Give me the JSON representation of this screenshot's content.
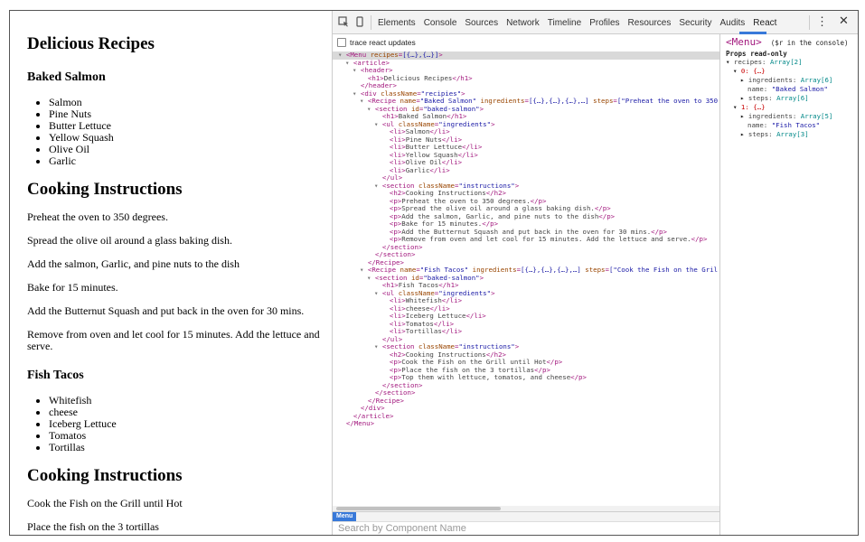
{
  "page": {
    "title": "Delicious Recipes",
    "recipes": [
      {
        "name": "Baked Salmon",
        "ingredients": [
          "Salmon",
          "Pine Nuts",
          "Butter Lettuce",
          "Yellow Squash",
          "Olive Oil",
          "Garlic"
        ],
        "instructions_title": "Cooking Instructions",
        "steps": [
          "Preheat the oven to 350 degrees.",
          "Spread the olive oil around a glass baking dish.",
          "Add the salmon, Garlic, and pine nuts to the dish",
          "Bake for 15 minutes.",
          "Add the Butternut Squash and put back in the oven for 30 mins.",
          "Remove from oven and let cool for 15 minutes. Add the lettuce and serve."
        ]
      },
      {
        "name": "Fish Tacos",
        "ingredients": [
          "Whitefish",
          "cheese",
          "Iceberg Lettuce",
          "Tomatos",
          "Tortillas"
        ],
        "instructions_title": "Cooking Instructions",
        "steps": [
          "Cook the Fish on the Grill until Hot",
          "Place the fish on the 3 tortillas",
          "Top them with lettuce, tomatos, and cheese"
        ]
      }
    ]
  },
  "devtools": {
    "tabs": [
      "Elements",
      "Console",
      "Sources",
      "Network",
      "Timeline",
      "Profiles",
      "Resources",
      "Security",
      "Audits",
      "React"
    ],
    "active_tab": "React",
    "trace_label": "trace react updates",
    "tree_lines": [
      {
        "d": 0,
        "a": "▾",
        "t": [
          [
            "tag",
            "<Menu "
          ],
          [
            "attr",
            "recipes"
          ],
          [
            "tag",
            "="
          ],
          [
            "val",
            "[{…},{…}]"
          ],
          [
            "tag",
            ">"
          ]
        ],
        "sel": true
      },
      {
        "d": 1,
        "a": "▾",
        "t": [
          [
            "tag",
            "<article>"
          ]
        ]
      },
      {
        "d": 2,
        "a": "▾",
        "t": [
          [
            "tag",
            "<header>"
          ]
        ]
      },
      {
        "d": 3,
        "a": "",
        "t": [
          [
            "tag",
            "<h1>"
          ],
          [
            "txt",
            "Delicious Recipes"
          ],
          [
            "tag",
            "</h1>"
          ]
        ]
      },
      {
        "d": 2,
        "a": "",
        "t": [
          [
            "tag",
            "</header>"
          ]
        ]
      },
      {
        "d": 2,
        "a": "▾",
        "t": [
          [
            "tag",
            "<div "
          ],
          [
            "attr",
            "className"
          ],
          [
            "tag",
            "="
          ],
          [
            "val",
            "\"recipies\""
          ],
          [
            "tag",
            ">"
          ]
        ]
      },
      {
        "d": 3,
        "a": "▾",
        "t": [
          [
            "tag",
            "<Recipe "
          ],
          [
            "attr",
            "name"
          ],
          [
            "tag",
            "="
          ],
          [
            "val",
            "\"Baked Salmon\""
          ],
          [
            "tag",
            " "
          ],
          [
            "attr",
            "ingredients"
          ],
          [
            "tag",
            "="
          ],
          [
            "val",
            "[{…},{…},{…},…]"
          ],
          [
            "tag",
            " "
          ],
          [
            "attr",
            "steps"
          ],
          [
            "tag",
            "="
          ],
          [
            "val",
            "[\"Preheat the oven to 350"
          ]
        ]
      },
      {
        "d": 4,
        "a": "▾",
        "t": [
          [
            "tag",
            "<section "
          ],
          [
            "attr",
            "id"
          ],
          [
            "tag",
            "="
          ],
          [
            "val",
            "\"baked-salmon\""
          ],
          [
            "tag",
            ">"
          ]
        ]
      },
      {
        "d": 5,
        "a": "",
        "t": [
          [
            "tag",
            "<h1>"
          ],
          [
            "txt",
            "Baked Salmon"
          ],
          [
            "tag",
            "</h1>"
          ]
        ]
      },
      {
        "d": 5,
        "a": "▾",
        "t": [
          [
            "tag",
            "<ul "
          ],
          [
            "attr",
            "className"
          ],
          [
            "tag",
            "="
          ],
          [
            "val",
            "\"ingredients\""
          ],
          [
            "tag",
            ">"
          ]
        ]
      },
      {
        "d": 6,
        "a": "",
        "t": [
          [
            "tag",
            "<li>"
          ],
          [
            "txt",
            "Salmon"
          ],
          [
            "tag",
            "</li>"
          ]
        ]
      },
      {
        "d": 6,
        "a": "",
        "t": [
          [
            "tag",
            "<li>"
          ],
          [
            "txt",
            "Pine Nuts"
          ],
          [
            "tag",
            "</li>"
          ]
        ]
      },
      {
        "d": 6,
        "a": "",
        "t": [
          [
            "tag",
            "<li>"
          ],
          [
            "txt",
            "Butter Lettuce"
          ],
          [
            "tag",
            "</li>"
          ]
        ]
      },
      {
        "d": 6,
        "a": "",
        "t": [
          [
            "tag",
            "<li>"
          ],
          [
            "txt",
            "Yellow Squash"
          ],
          [
            "tag",
            "</li>"
          ]
        ]
      },
      {
        "d": 6,
        "a": "",
        "t": [
          [
            "tag",
            "<li>"
          ],
          [
            "txt",
            "Olive Oil"
          ],
          [
            "tag",
            "</li>"
          ]
        ]
      },
      {
        "d": 6,
        "a": "",
        "t": [
          [
            "tag",
            "<li>"
          ],
          [
            "txt",
            "Garlic"
          ],
          [
            "tag",
            "</li>"
          ]
        ]
      },
      {
        "d": 5,
        "a": "",
        "t": [
          [
            "tag",
            "</ul>"
          ]
        ]
      },
      {
        "d": 5,
        "a": "▾",
        "t": [
          [
            "tag",
            "<section "
          ],
          [
            "attr",
            "className"
          ],
          [
            "tag",
            "="
          ],
          [
            "val",
            "\"instructions\""
          ],
          [
            "tag",
            ">"
          ]
        ]
      },
      {
        "d": 6,
        "a": "",
        "t": [
          [
            "tag",
            "<h2>"
          ],
          [
            "txt",
            "Cooking Instructions"
          ],
          [
            "tag",
            "</h2>"
          ]
        ]
      },
      {
        "d": 6,
        "a": "",
        "t": [
          [
            "tag",
            "<p>"
          ],
          [
            "txt",
            "Preheat the oven to 350 degrees."
          ],
          [
            "tag",
            "</p>"
          ]
        ]
      },
      {
        "d": 6,
        "a": "",
        "t": [
          [
            "tag",
            "<p>"
          ],
          [
            "txt",
            "Spread the olive oil around a glass baking dish."
          ],
          [
            "tag",
            "</p>"
          ]
        ]
      },
      {
        "d": 6,
        "a": "",
        "t": [
          [
            "tag",
            "<p>"
          ],
          [
            "txt",
            "Add the salmon, Garlic, and pine nuts to the dish"
          ],
          [
            "tag",
            "</p>"
          ]
        ]
      },
      {
        "d": 6,
        "a": "",
        "t": [
          [
            "tag",
            "<p>"
          ],
          [
            "txt",
            "Bake for 15 minutes."
          ],
          [
            "tag",
            "</p>"
          ]
        ]
      },
      {
        "d": 6,
        "a": "",
        "t": [
          [
            "tag",
            "<p>"
          ],
          [
            "txt",
            "Add the Butternut Squash and put back in the oven for 30 mins."
          ],
          [
            "tag",
            "</p>"
          ]
        ]
      },
      {
        "d": 6,
        "a": "",
        "t": [
          [
            "tag",
            "<p>"
          ],
          [
            "txt",
            "Remove from oven and let cool for 15 minutes. Add the lettuce and serve."
          ],
          [
            "tag",
            "</p>"
          ]
        ]
      },
      {
        "d": 5,
        "a": "",
        "t": [
          [
            "tag",
            "</section>"
          ]
        ]
      },
      {
        "d": 4,
        "a": "",
        "t": [
          [
            "tag",
            "</section>"
          ]
        ]
      },
      {
        "d": 3,
        "a": "",
        "t": [
          [
            "tag",
            "</Recipe>"
          ]
        ]
      },
      {
        "d": 3,
        "a": "▾",
        "t": [
          [
            "tag",
            "<Recipe "
          ],
          [
            "attr",
            "name"
          ],
          [
            "tag",
            "="
          ],
          [
            "val",
            "\"Fish Tacos\""
          ],
          [
            "tag",
            " "
          ],
          [
            "attr",
            "ingredients"
          ],
          [
            "tag",
            "="
          ],
          [
            "val",
            "[{…},{…},{…},…]"
          ],
          [
            "tag",
            " "
          ],
          [
            "attr",
            "steps"
          ],
          [
            "tag",
            "="
          ],
          [
            "val",
            "[\"Cook the Fish on the Gril"
          ]
        ]
      },
      {
        "d": 4,
        "a": "▾",
        "t": [
          [
            "tag",
            "<section "
          ],
          [
            "attr",
            "id"
          ],
          [
            "tag",
            "="
          ],
          [
            "val",
            "\"baked-salmon\""
          ],
          [
            "tag",
            ">"
          ]
        ]
      },
      {
        "d": 5,
        "a": "",
        "t": [
          [
            "tag",
            "<h1>"
          ],
          [
            "txt",
            "Fish Tacos"
          ],
          [
            "tag",
            "</h1>"
          ]
        ]
      },
      {
        "d": 5,
        "a": "▾",
        "t": [
          [
            "tag",
            "<ul "
          ],
          [
            "attr",
            "className"
          ],
          [
            "tag",
            "="
          ],
          [
            "val",
            "\"ingredients\""
          ],
          [
            "tag",
            ">"
          ]
        ]
      },
      {
        "d": 6,
        "a": "",
        "t": [
          [
            "tag",
            "<li>"
          ],
          [
            "txt",
            "Whitefish"
          ],
          [
            "tag",
            "</li>"
          ]
        ]
      },
      {
        "d": 6,
        "a": "",
        "t": [
          [
            "tag",
            "<li>"
          ],
          [
            "txt",
            "cheese"
          ],
          [
            "tag",
            "</li>"
          ]
        ]
      },
      {
        "d": 6,
        "a": "",
        "t": [
          [
            "tag",
            "<li>"
          ],
          [
            "txt",
            "Iceberg Lettuce"
          ],
          [
            "tag",
            "</li>"
          ]
        ]
      },
      {
        "d": 6,
        "a": "",
        "t": [
          [
            "tag",
            "<li>"
          ],
          [
            "txt",
            "Tomatos"
          ],
          [
            "tag",
            "</li>"
          ]
        ]
      },
      {
        "d": 6,
        "a": "",
        "t": [
          [
            "tag",
            "<li>"
          ],
          [
            "txt",
            "Tortillas"
          ],
          [
            "tag",
            "</li>"
          ]
        ]
      },
      {
        "d": 5,
        "a": "",
        "t": [
          [
            "tag",
            "</ul>"
          ]
        ]
      },
      {
        "d": 5,
        "a": "▾",
        "t": [
          [
            "tag",
            "<section "
          ],
          [
            "attr",
            "className"
          ],
          [
            "tag",
            "="
          ],
          [
            "val",
            "\"instructions\""
          ],
          [
            "tag",
            ">"
          ]
        ]
      },
      {
        "d": 6,
        "a": "",
        "t": [
          [
            "tag",
            "<h2>"
          ],
          [
            "txt",
            "Cooking Instructions"
          ],
          [
            "tag",
            "</h2>"
          ]
        ]
      },
      {
        "d": 6,
        "a": "",
        "t": [
          [
            "tag",
            "<p>"
          ],
          [
            "txt",
            "Cook the Fish on the Grill until Hot"
          ],
          [
            "tag",
            "</p>"
          ]
        ]
      },
      {
        "d": 6,
        "a": "",
        "t": [
          [
            "tag",
            "<p>"
          ],
          [
            "txt",
            "Place the fish on the 3 tortillas"
          ],
          [
            "tag",
            "</p>"
          ]
        ]
      },
      {
        "d": 6,
        "a": "",
        "t": [
          [
            "tag",
            "<p>"
          ],
          [
            "txt",
            "Top them with lettuce, tomatos, and cheese"
          ],
          [
            "tag",
            "</p>"
          ]
        ]
      },
      {
        "d": 5,
        "a": "",
        "t": [
          [
            "tag",
            "</section>"
          ]
        ]
      },
      {
        "d": 4,
        "a": "",
        "t": [
          [
            "tag",
            "</section>"
          ]
        ]
      },
      {
        "d": 3,
        "a": "",
        "t": [
          [
            "tag",
            "</Recipe>"
          ]
        ]
      },
      {
        "d": 2,
        "a": "",
        "t": [
          [
            "tag",
            "</div>"
          ]
        ]
      },
      {
        "d": 1,
        "a": "",
        "t": [
          [
            "tag",
            "</article>"
          ]
        ]
      },
      {
        "d": 0,
        "a": "",
        "t": [
          [
            "tag",
            "</Menu>"
          ]
        ]
      }
    ],
    "breadcrumb": "Menu",
    "search_placeholder": "Search by Component Name",
    "props_panel": {
      "component": "<Menu>",
      "hint": "($r in the console)",
      "readonly_label": "Props read-only",
      "lines": [
        {
          "d": 0,
          "a": "▾",
          "k": "recipes",
          "v": "Array[2]",
          "vt": "type"
        },
        {
          "d": 1,
          "a": "▾",
          "k": "0",
          "v": "{…}",
          "vt": "obj"
        },
        {
          "d": 2,
          "a": "▸",
          "k": "ingredients",
          "v": "Array[6]",
          "vt": "type"
        },
        {
          "d": 2,
          "a": "",
          "k": "name",
          "v": "\"Baked Salmon\"",
          "vt": "str"
        },
        {
          "d": 2,
          "a": "▸",
          "k": "steps",
          "v": "Array[6]",
          "vt": "type"
        },
        {
          "d": 1,
          "a": "▾",
          "k": "1",
          "v": "{…}",
          "vt": "obj"
        },
        {
          "d": 2,
          "a": "▸",
          "k": "ingredients",
          "v": "Array[5]",
          "vt": "type"
        },
        {
          "d": 2,
          "a": "",
          "k": "name",
          "v": "\"Fish Tacos\"",
          "vt": "str"
        },
        {
          "d": 2,
          "a": "▸",
          "k": "steps",
          "v": "Array[3]",
          "vt": "type"
        }
      ]
    }
  }
}
